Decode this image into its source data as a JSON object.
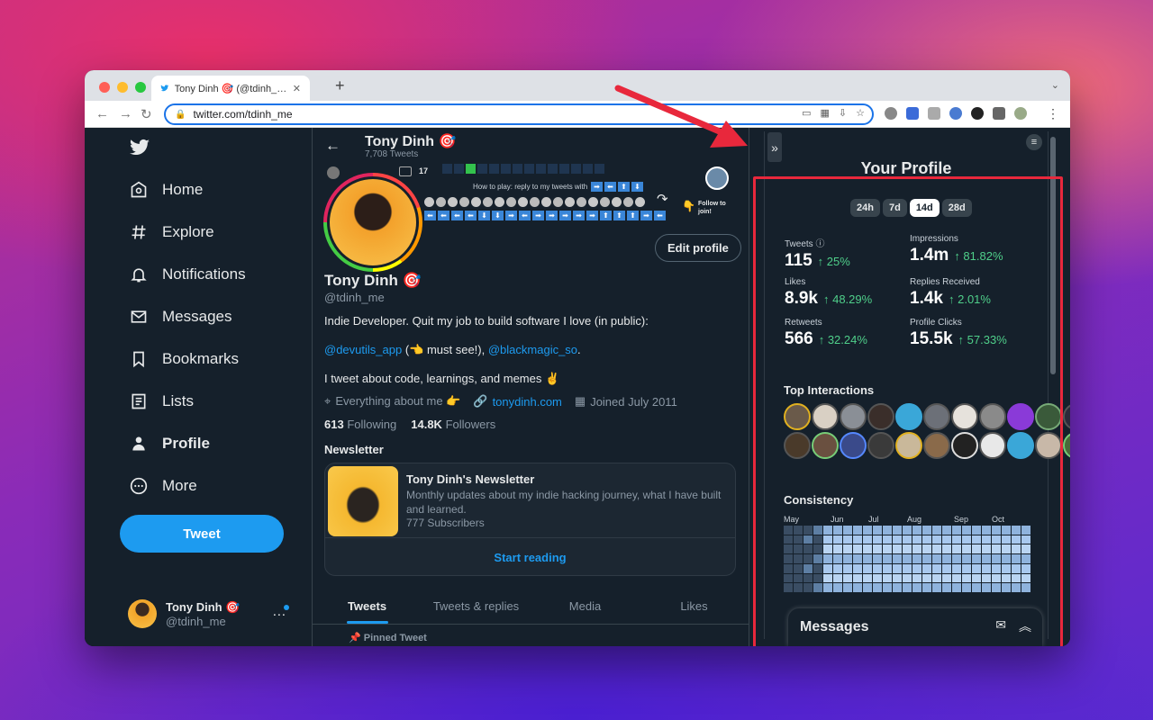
{
  "browser": {
    "tab_title": "Tony Dinh 🎯 (@tdinh_me) / Tw",
    "url": "twitter.com/tdinh_me"
  },
  "sidebar": {
    "items": [
      {
        "label": "Home",
        "icon": "home-icon"
      },
      {
        "label": "Explore",
        "icon": "hash-icon"
      },
      {
        "label": "Notifications",
        "icon": "bell-icon"
      },
      {
        "label": "Messages",
        "icon": "mail-icon"
      },
      {
        "label": "Bookmarks",
        "icon": "bookmark-icon"
      },
      {
        "label": "Lists",
        "icon": "list-icon"
      },
      {
        "label": "Profile",
        "icon": "person-icon"
      },
      {
        "label": "More",
        "icon": "more-icon"
      }
    ],
    "tweet_button": "Tweet",
    "account": {
      "name": "Tony Dinh 🎯",
      "handle": "@tdinh_me"
    }
  },
  "header": {
    "title": "Tony Dinh 🎯",
    "subtitle": "7,708 Tweets"
  },
  "banner": {
    "count": "17",
    "how_to": "How to play: reply to my tweets with",
    "follow_cta": "Follow to join!"
  },
  "profile": {
    "edit_button": "Edit profile",
    "name": "Tony Dinh 🎯",
    "handle": "@tdinh_me",
    "bio_line1": "Indie Developer. Quit my job to build software I love (in public):",
    "bio_link1": "@devutils_app",
    "bio_mid": " (👈 must see!), ",
    "bio_link2": "@blackmagic_so",
    "bio_end": ".",
    "bio_line3": "I tweet about code, learnings, and memes ✌️",
    "location": "Everything about me 👉",
    "website": "tonydinh.com",
    "joined": "Joined July 2011",
    "following_count": "613",
    "following_label": "Following",
    "followers_count": "14.8K",
    "followers_label": "Followers"
  },
  "newsletter": {
    "heading": "Newsletter",
    "title": "Tony Dinh's Newsletter",
    "description": "Monthly updates about my indie hacking journey, what I have built and learned.",
    "subscribers": "777 Subscribers",
    "cta": "Start reading"
  },
  "tabs": [
    "Tweets",
    "Tweets & replies",
    "Media",
    "Likes"
  ],
  "pinned": "Pinned Tweet",
  "extension": {
    "title": "Your Profile",
    "ranges": [
      "24h",
      "7d",
      "14d",
      "28d"
    ],
    "active_range": "14d",
    "stats": [
      {
        "label": "Tweets",
        "value": "115",
        "delta": "↑ 25%"
      },
      {
        "label": "Impressions",
        "value": "1.4m",
        "delta": "↑ 81.82%"
      },
      {
        "label": "Likes",
        "value": "8.9k",
        "delta": "↑ 48.29%"
      },
      {
        "label": "Replies Received",
        "value": "1.4k",
        "delta": "↑ 2.01%"
      },
      {
        "label": "Retweets",
        "value": "566",
        "delta": "↑ 32.24%"
      },
      {
        "label": "Profile Clicks",
        "value": "15.5k",
        "delta": "↑ 57.33%"
      }
    ],
    "top_interactions": "Top Interactions",
    "consistency": "Consistency",
    "months": [
      "May",
      "Jun",
      "Jul",
      "Aug",
      "Sep",
      "Oct"
    ],
    "messages": "Messages"
  },
  "colors": {
    "accent": "#1d9bf0",
    "positive": "#4fcf8a",
    "highlight": "#e8283c",
    "background": "#15202b"
  }
}
